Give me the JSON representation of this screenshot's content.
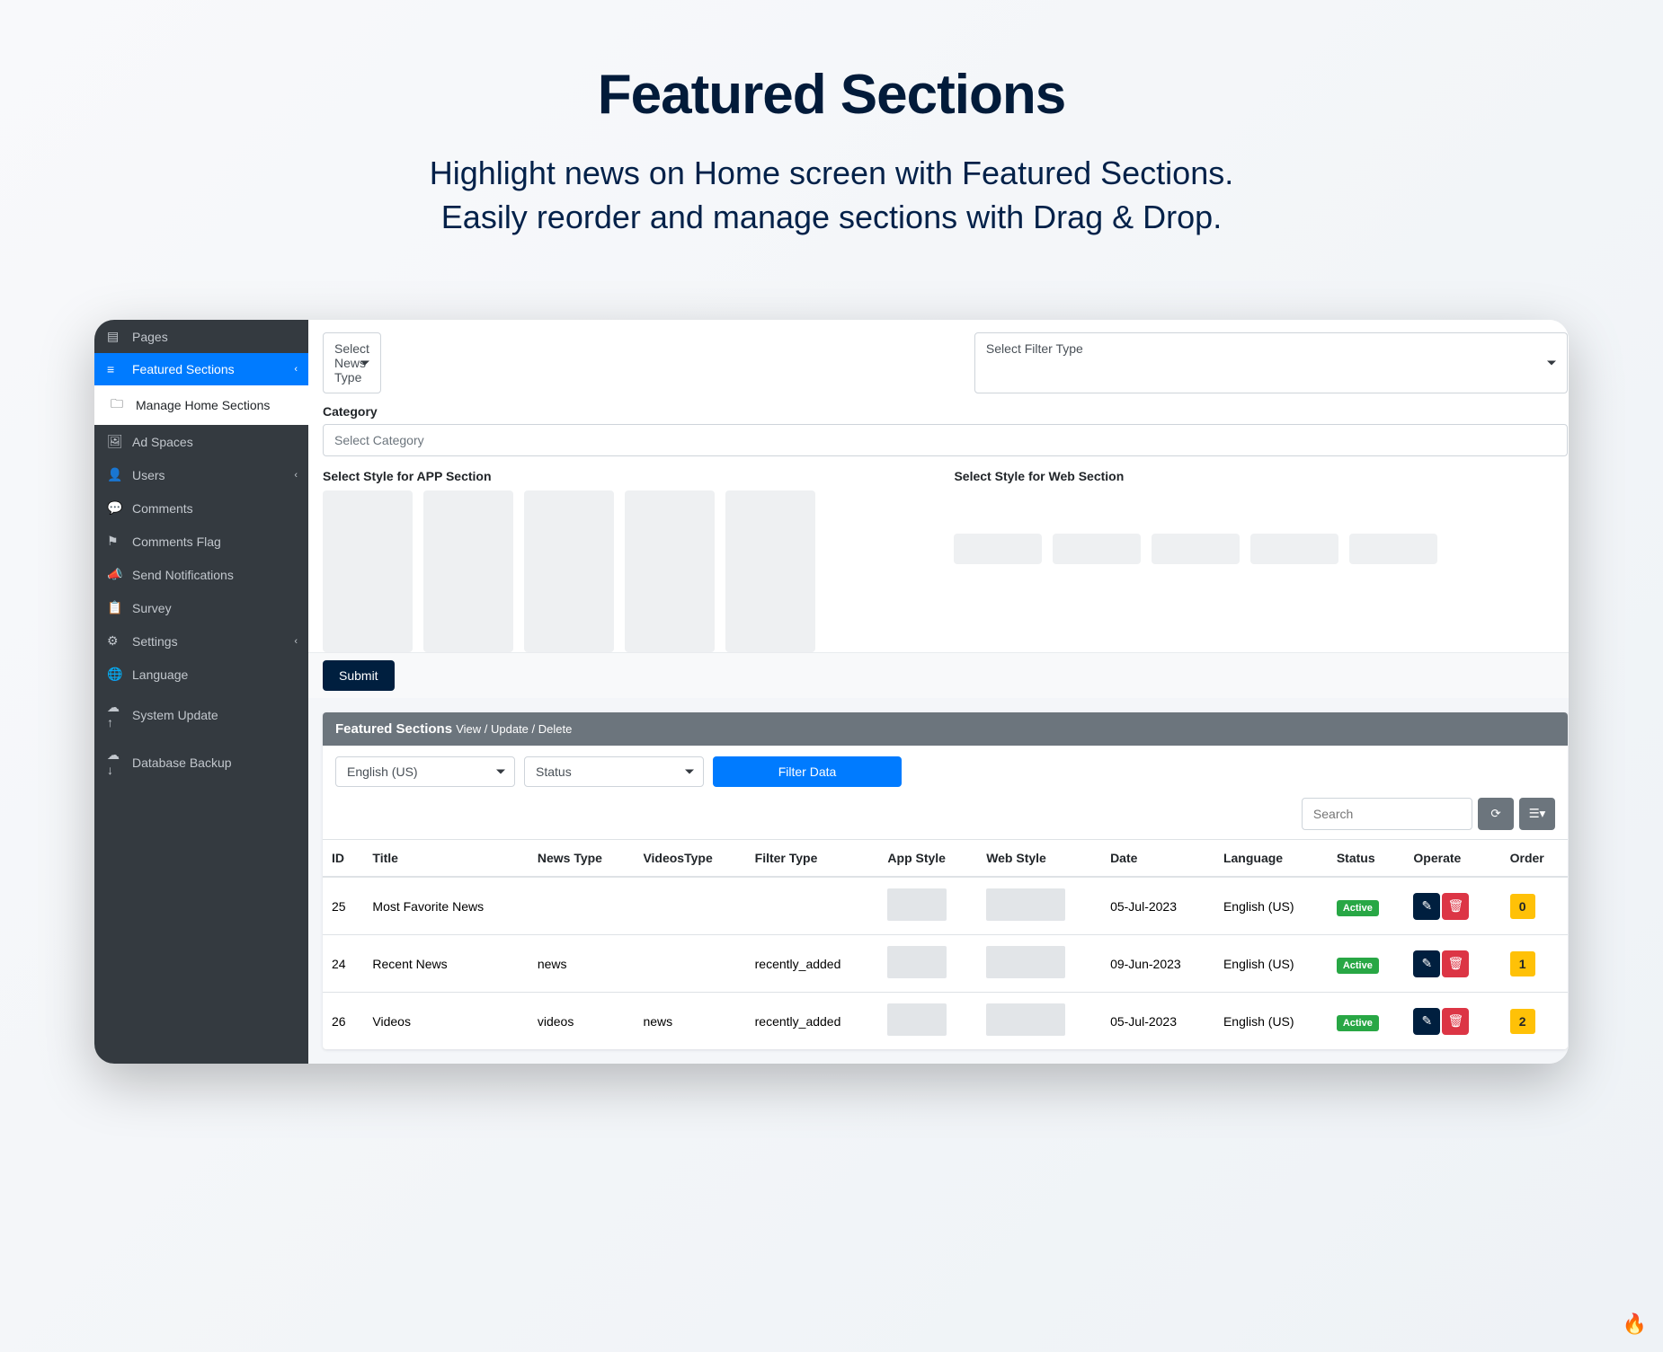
{
  "hero": {
    "title": "Featured Sections",
    "subtitle_l1": "Highlight news on Home screen with Featured Sections.",
    "subtitle_l2": "Easily reorder and manage sections with Drag & Drop."
  },
  "sidebar": {
    "items": [
      {
        "label": "Pages",
        "icon": "file-icon"
      },
      {
        "label": "Featured Sections",
        "icon": "layers-icon",
        "active": true,
        "chev": true
      },
      {
        "label": "Manage Home Sections",
        "icon": "folder-icon",
        "sub": true
      },
      {
        "label": "Ad Spaces",
        "icon": "image-icon"
      },
      {
        "label": "Users",
        "icon": "user-icon",
        "chev": true
      },
      {
        "label": "Comments",
        "icon": "comments-icon"
      },
      {
        "label": "Comments Flag",
        "icon": "flag-icon"
      },
      {
        "label": "Send Notifications",
        "icon": "bullhorn-icon"
      },
      {
        "label": "Survey",
        "icon": "clipboard-icon"
      },
      {
        "label": "Settings",
        "icon": "gear-icon",
        "chev": true
      },
      {
        "label": "Language",
        "icon": "language-icon"
      },
      {
        "label": "System Update",
        "icon": "cloud-up-icon"
      },
      {
        "label": "Database Backup",
        "icon": "cloud-down-icon"
      }
    ]
  },
  "form": {
    "news_type_placeholder": "Select News Type",
    "filter_type_placeholder": "Select Filter Type",
    "category_label": "Category",
    "category_placeholder": "Select Category",
    "style_app_label": "Select Style for APP Section",
    "style_web_label": "Select Style for Web Section",
    "submit": "Submit"
  },
  "table_card": {
    "title": "Featured Sections",
    "subtitle": "View / Update / Delete",
    "lang_filter": "English (US)",
    "status_filter": "Status",
    "filter_btn": "Filter Data",
    "search_placeholder": "Search"
  },
  "table": {
    "headers": [
      "ID",
      "Title",
      "News Type",
      "VideosType",
      "Filter Type",
      "App Style",
      "Web Style",
      "Date",
      "Language",
      "Status",
      "Operate",
      "Order"
    ],
    "rows": [
      {
        "id": "25",
        "title": "Most Favorite News",
        "news_type": "",
        "videos_type": "",
        "filter_type": "",
        "date": "05-Jul-2023",
        "lang": "English (US)",
        "status": "Active",
        "order": "0"
      },
      {
        "id": "24",
        "title": "Recent News",
        "news_type": "news",
        "videos_type": "",
        "filter_type": "recently_added",
        "date": "09-Jun-2023",
        "lang": "English (US)",
        "status": "Active",
        "order": "1"
      },
      {
        "id": "26",
        "title": "Videos",
        "news_type": "videos",
        "videos_type": "news",
        "filter_type": "recently_added",
        "date": "05-Jul-2023",
        "lang": "English (US)",
        "status": "Active",
        "order": "2"
      }
    ]
  }
}
